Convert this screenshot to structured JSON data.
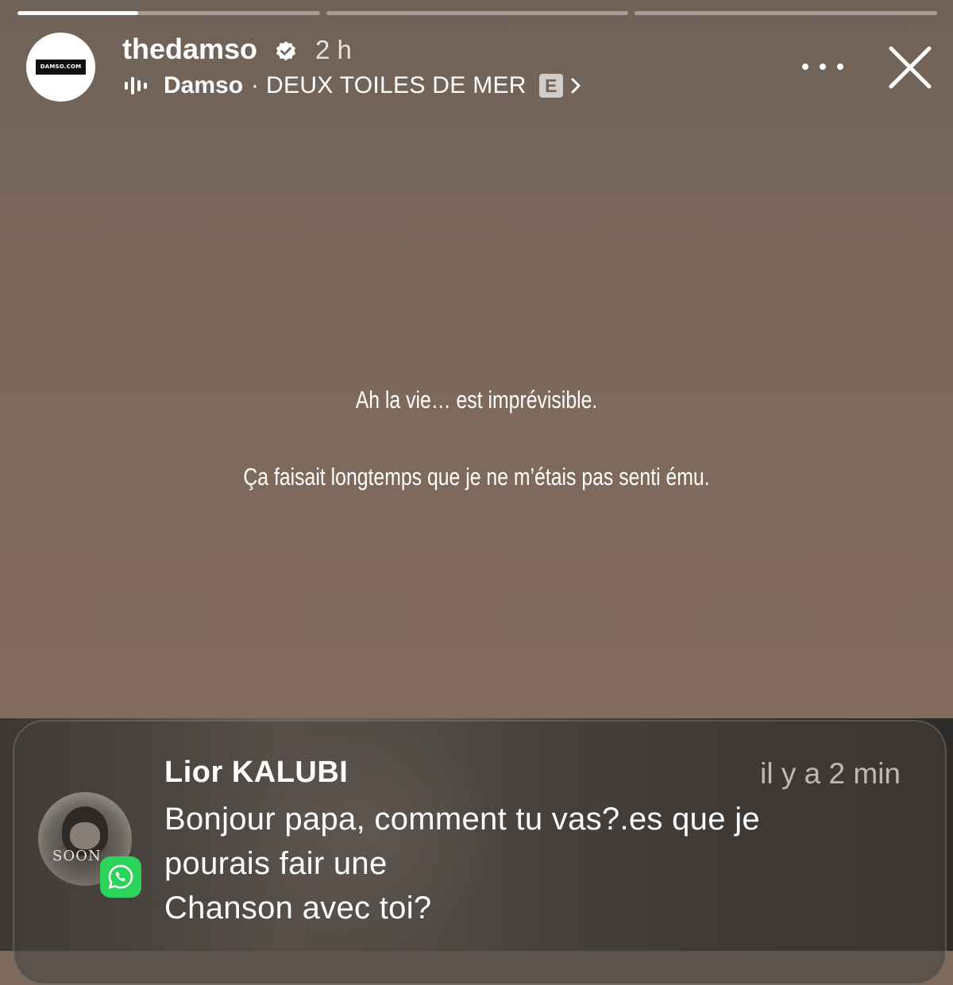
{
  "progress": {
    "segments": [
      {
        "fill": 0.4
      },
      {
        "fill": 0
      },
      {
        "fill": 0
      }
    ]
  },
  "header": {
    "avatar_logo_text": "DAMSO.COM",
    "username": "thedamso",
    "time": "2 h",
    "music": {
      "artist": "Damso",
      "separator": "·",
      "song": "DEUX TOILES DE MER",
      "explicit_badge": "E"
    },
    "icons": {
      "verified": "verified-badge-icon",
      "music": "audio-bars-icon",
      "chevron": "chevron-right-icon",
      "more": "more-options-icon",
      "close": "close-icon"
    }
  },
  "story": {
    "line1": "Ah la vie… est imprévisible.",
    "line2": "Ça faisait longtemps que je ne m’étais pas senti ému."
  },
  "notification": {
    "sender": "Lior KALUBI",
    "time": "il y a 2 min",
    "message": "Bonjour papa, comment tu vas?.es que je\npourais fair une\nChanson avec toi?",
    "avatar_text": "SOON",
    "app_icon": "whatsapp-icon",
    "app_color": "#2bd35a"
  },
  "colors": {
    "story_background": "#7d6b5d"
  }
}
